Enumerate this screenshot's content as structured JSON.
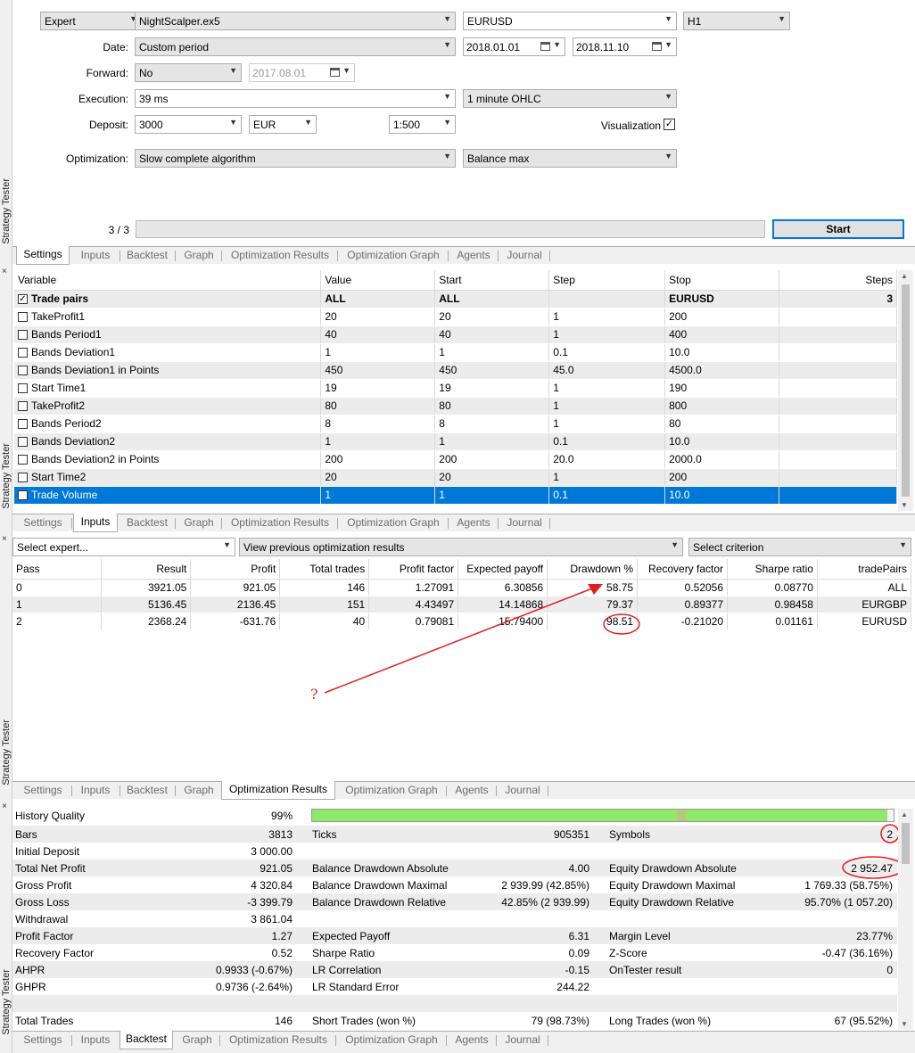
{
  "side": {
    "label": "Strategy Tester",
    "close": "×"
  },
  "settings": {
    "type": "Expert",
    "expert_file": "NightScalper.ex5",
    "symbol": "EURUSD",
    "timeframe": "H1",
    "date_label": "Date:",
    "date_mode": "Custom period",
    "date_from": "2018.01.01",
    "date_to": "2018.11.10",
    "forward_label": "Forward:",
    "forward_mode": "No",
    "forward_date": "2017.08.01",
    "execution_label": "Execution:",
    "execution": "39 ms",
    "model": "1 minute OHLC",
    "deposit_label": "Deposit:",
    "deposit": "3000",
    "currency": "EUR",
    "leverage": "1:500",
    "visualization_label": "Visualization",
    "visualization_checked": "✓",
    "optimization_label": "Optimization:",
    "optimization": "Slow complete algorithm",
    "criterion": "Balance max",
    "progress_text": "3 / 3",
    "start_label": "Start"
  },
  "tabs": [
    "Settings",
    "Inputs",
    "Backtest",
    "Graph",
    "Optimization Results",
    "Optimization Graph",
    "Agents",
    "Journal"
  ],
  "inputs": {
    "headers": [
      "Variable",
      "Value",
      "Start",
      "Step",
      "Stop",
      "Steps"
    ],
    "rows": [
      {
        "check": "✓",
        "name": "Trade pairs",
        "value": "ALL",
        "start": "ALL",
        "step": "",
        "stop": "EURUSD",
        "steps": "3"
      },
      {
        "check": "",
        "name": "TakeProfit1",
        "value": "20",
        "start": "20",
        "step": "1",
        "stop": "200",
        "steps": ""
      },
      {
        "check": "",
        "name": "Bands Period1",
        "value": "40",
        "start": "40",
        "step": "1",
        "stop": "400",
        "steps": ""
      },
      {
        "check": "",
        "name": "Bands Deviation1",
        "value": "1",
        "start": "1",
        "step": "0.1",
        "stop": "10.0",
        "steps": ""
      },
      {
        "check": "",
        "name": "Bands Deviation1 in Points",
        "value": "450",
        "start": "450",
        "step": "45.0",
        "stop": "4500.0",
        "steps": ""
      },
      {
        "check": "",
        "name": "Start Time1",
        "value": "19",
        "start": "19",
        "step": "1",
        "stop": "190",
        "steps": ""
      },
      {
        "check": "",
        "name": "TakeProfit2",
        "value": "80",
        "start": "80",
        "step": "1",
        "stop": "800",
        "steps": ""
      },
      {
        "check": "",
        "name": "Bands Period2",
        "value": "8",
        "start": "8",
        "step": "1",
        "stop": "80",
        "steps": ""
      },
      {
        "check": "",
        "name": "Bands Deviation2",
        "value": "1",
        "start": "1",
        "step": "0.1",
        "stop": "10.0",
        "steps": ""
      },
      {
        "check": "",
        "name": "Bands Deviation2 in Points",
        "value": "200",
        "start": "200",
        "step": "20.0",
        "stop": "2000.0",
        "steps": ""
      },
      {
        "check": "",
        "name": "Start Time2",
        "value": "20",
        "start": "20",
        "step": "1",
        "stop": "200",
        "steps": ""
      },
      {
        "check": "",
        "name": "Trade Volume",
        "value": "1",
        "start": "1",
        "step": "0.1",
        "stop": "10.0",
        "steps": ""
      }
    ]
  },
  "results": {
    "select_expert": "Select expert...",
    "view_mode": "View previous optimization results",
    "select_criterion": "Select criterion",
    "headers": [
      "Pass",
      "Result",
      "Profit",
      "Total trades",
      "Profit factor",
      "Expected payoff",
      "Drawdown %",
      "Recovery factor",
      "Sharpe ratio",
      "tradePairs"
    ],
    "rows": [
      [
        "0",
        "3921.05",
        "921.05",
        "146",
        "1.27091",
        "6.30856",
        "58.75",
        "0.52056",
        "0.08770",
        "ALL"
      ],
      [
        "1",
        "5136.45",
        "2136.45",
        "151",
        "4.43497",
        "14.14868",
        "79.37",
        "0.89377",
        "0.98458",
        "EURGBP"
      ],
      [
        "2",
        "2368.24",
        "-631.76",
        "40",
        "0.79081",
        "15.79400",
        "98.51",
        "-0.21020",
        "0.01161",
        "EURUSD"
      ]
    ],
    "annotation": "?"
  },
  "backtest": {
    "history_quality_label": "History Quality",
    "history_quality": "99%",
    "history_quality_fraction": 0.99,
    "rows": [
      {
        "c1l": "Bars",
        "c1v": "3813",
        "c2l": "Ticks",
        "c2v": "905351",
        "c3l": "Symbols",
        "c3v": "2"
      },
      {
        "c1l": "Initial Deposit",
        "c1v": "3 000.00",
        "c2l": "",
        "c2v": "",
        "c3l": "",
        "c3v": ""
      },
      {
        "c1l": "Total Net Profit",
        "c1v": "921.05",
        "c2l": "Balance Drawdown Absolute",
        "c2v": "4.00",
        "c3l": "Equity Drawdown Absolute",
        "c3v": "2 952.47"
      },
      {
        "c1l": "Gross Profit",
        "c1v": "4 320.84",
        "c2l": "Balance Drawdown Maximal",
        "c2v": "2 939.99 (42.85%)",
        "c3l": "Equity Drawdown Maximal",
        "c3v": "1 769.33 (58.75%)"
      },
      {
        "c1l": "Gross Loss",
        "c1v": "-3 399.79",
        "c2l": "Balance Drawdown Relative",
        "c2v": "42.85% (2 939.99)",
        "c3l": "Equity Drawdown Relative",
        "c3v": "95.70% (1 057.20)"
      },
      {
        "c1l": "Withdrawal",
        "c1v": "3 861.04",
        "c2l": "",
        "c2v": "",
        "c3l": "",
        "c3v": ""
      },
      {
        "c1l": "Profit Factor",
        "c1v": "1.27",
        "c2l": "Expected Payoff",
        "c2v": "6.31",
        "c3l": "Margin Level",
        "c3v": "23.77%"
      },
      {
        "c1l": "Recovery Factor",
        "c1v": "0.52",
        "c2l": "Sharpe Ratio",
        "c2v": "0.09",
        "c3l": "Z-Score",
        "c3v": "-0.47 (36.16%)"
      },
      {
        "c1l": "AHPR",
        "c1v": "0.9933 (-0.67%)",
        "c2l": "LR Correlation",
        "c2v": "-0.15",
        "c3l": "OnTester result",
        "c3v": "0"
      },
      {
        "c1l": "GHPR",
        "c1v": "0.9736 (-2.64%)",
        "c2l": "LR Standard Error",
        "c2v": "244.22",
        "c3l": "",
        "c3v": ""
      },
      {
        "c1l": "",
        "c1v": "",
        "c2l": "",
        "c2v": "",
        "c3l": "",
        "c3v": ""
      },
      {
        "c1l": "Total Trades",
        "c1v": "146",
        "c2l": "Short Trades (won %)",
        "c2v": "79 (98.73%)",
        "c3l": "Long Trades (won %)",
        "c3v": "67 (95.52%)"
      }
    ]
  },
  "colors": {
    "accent": "#0078d7",
    "quality_bar": "#8ee86a",
    "annotation": "#e02020"
  }
}
